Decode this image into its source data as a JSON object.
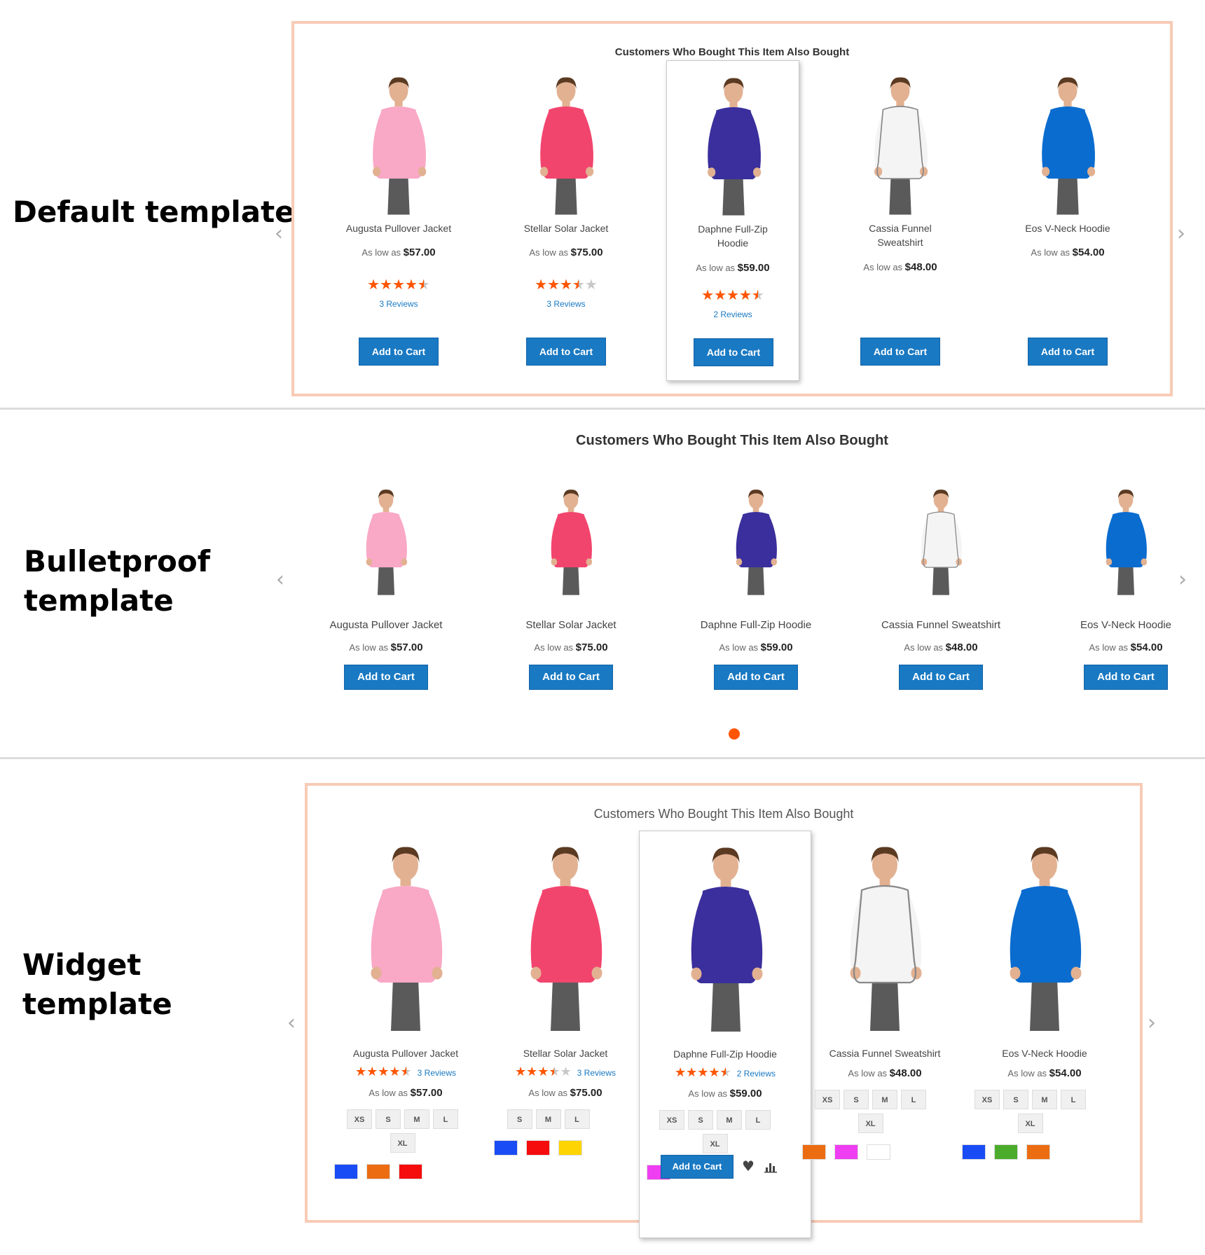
{
  "labels": {
    "default": "Default template",
    "bulletproof_l1": "Bulletproof",
    "bulletproof_l2": "template",
    "widget_l1": "Widget",
    "widget_l2": "template"
  },
  "block_title": "Customers Who Bought This Item Also Bought",
  "price_prefix": "As low as",
  "add_to_cart": "Add to Cart",
  "icons": {
    "prev": "chevron-left-icon",
    "next": "chevron-right-icon",
    "wishlist": "heart-icon",
    "compare": "bar-chart-icon"
  },
  "colors": {
    "accent_button": "#1979c3",
    "star": "#ff5501",
    "frame_border": "#f7cbb6",
    "active_dot": "#ff5501"
  },
  "products": [
    {
      "name": "Augusta Pullover Jacket",
      "price": "$57.00",
      "rating": 4.5,
      "reviews": "3  Reviews",
      "sizes": [
        "XS",
        "S",
        "M",
        "L",
        "XL"
      ],
      "colors": [
        "#1a4cf5",
        "#ec6c12",
        "#f50c0c"
      ]
    },
    {
      "name": "Stellar Solar Jacket",
      "price": "$75.00",
      "rating": 3.5,
      "reviews": "3  Reviews",
      "sizes": [
        "S",
        "M",
        "L"
      ],
      "colors": [
        "#1a4cf5",
        "#f50c0c",
        "#fed503"
      ]
    },
    {
      "name": "Daphne Full-Zip Hoodie",
      "price": "$59.00",
      "rating": 4.5,
      "reviews": "2  Reviews",
      "sizes": [
        "XS",
        "S",
        "M",
        "L",
        "XL"
      ],
      "colors": [
        "#ef3df2"
      ]
    },
    {
      "name": "Cassia Funnel Sweatshirt",
      "price": "$48.00",
      "rating": 0,
      "reviews": "",
      "sizes": [
        "XS",
        "S",
        "M",
        "L",
        "XL"
      ],
      "colors": [
        "#ec6c12",
        "#ef3df2",
        "#ffffff"
      ]
    },
    {
      "name": "Eos V-Neck Hoodie",
      "price": "$54.00",
      "rating": 0,
      "reviews": "",
      "sizes": [
        "XS",
        "S",
        "M",
        "L",
        "XL"
      ],
      "colors": [
        "#1a4cf5",
        "#4bac2b",
        "#ec6c12"
      ]
    }
  ],
  "default_names": [
    [
      "Augusta Pullover Jacket"
    ],
    [
      "Stellar Solar Jacket"
    ],
    [
      "Daphne Full-Zip",
      "Hoodie"
    ],
    [
      "Cassia Funnel",
      "Sweatshirt"
    ],
    [
      "Eos V-Neck Hoodie"
    ]
  ]
}
